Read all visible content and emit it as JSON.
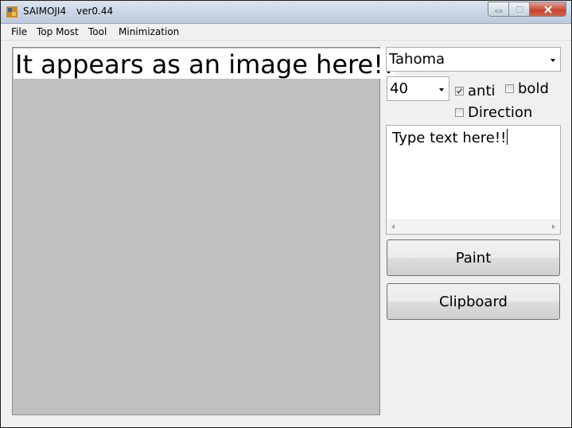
{
  "window": {
    "title": "SAIMOJI4",
    "version": "ver0.44",
    "icon": "app-icon",
    "controls": [
      "minimize-icon",
      "maximize-icon",
      "close-icon"
    ]
  },
  "menu": {
    "file": "File",
    "top_most": "Top Most",
    "tool": "Tool",
    "minimization": "Minimization"
  },
  "preview": {
    "text": "It appears as an image here!!",
    "background_color": "#c0c0c0"
  },
  "font": {
    "family_value": "Tahoma",
    "size_value": "40"
  },
  "options": {
    "anti_label": "anti",
    "anti_checked": true,
    "bold_label": "bold",
    "bold_checked": false,
    "direction_label": "Direction",
    "direction_checked": false
  },
  "input": {
    "value": "Type text here!!"
  },
  "buttons": {
    "paint": "Paint",
    "clipboard": "Clipboard"
  }
}
